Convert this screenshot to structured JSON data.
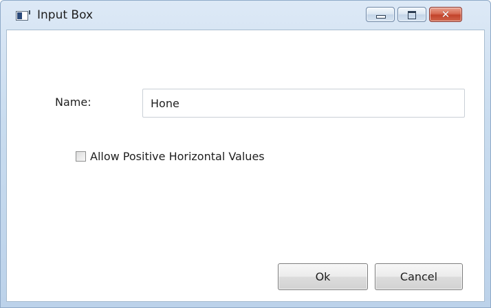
{
  "window": {
    "title": "Input Box",
    "icon": "application-window-icon",
    "controls": {
      "minimize": "minimize-icon",
      "maximize": "maximize-icon",
      "close": "close-icon",
      "close_glyph": "✕"
    }
  },
  "form": {
    "name_label": "Name:",
    "name_value": "Hone",
    "checkbox_label": "Allow Positive Horizontal Values",
    "checkbox_checked": false
  },
  "buttons": {
    "ok_label": "Ok",
    "cancel_label": "Cancel"
  },
  "colors": {
    "close_button": "#c2432b",
    "frame": "#bcd2ea"
  }
}
